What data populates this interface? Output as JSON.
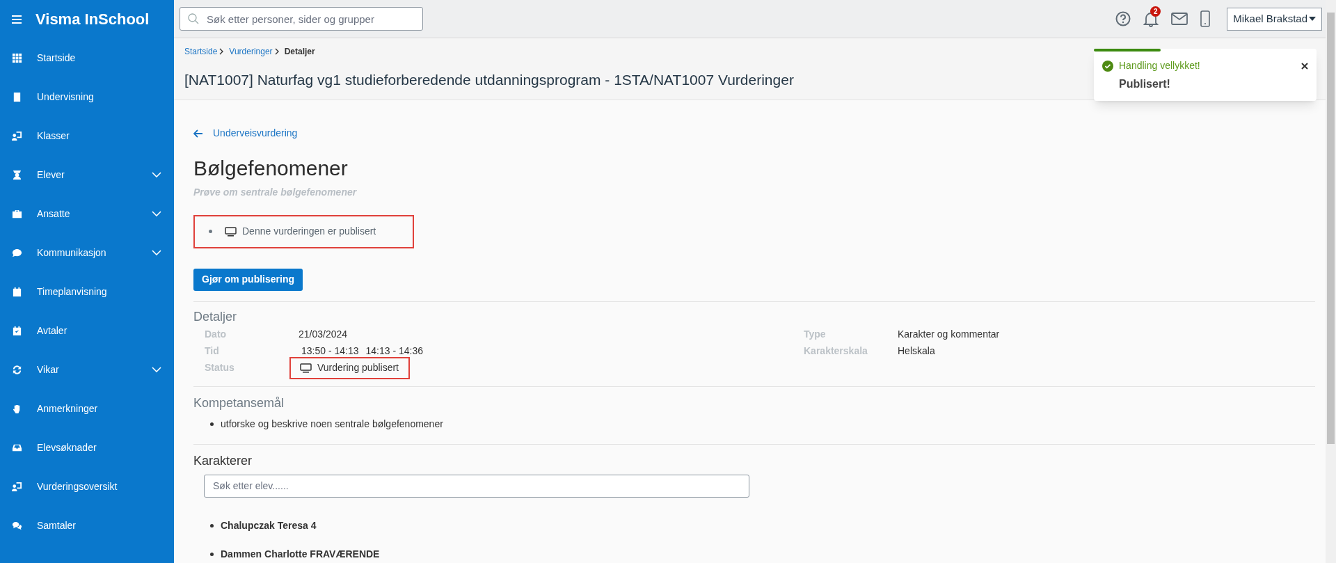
{
  "sidebar": {
    "title": "Visma InSchool",
    "items": [
      {
        "label": "Startside",
        "expandable": false
      },
      {
        "label": "Undervisning",
        "expandable": false
      },
      {
        "label": "Klasser",
        "expandable": false
      },
      {
        "label": "Elever",
        "expandable": true
      },
      {
        "label": "Ansatte",
        "expandable": true
      },
      {
        "label": "Kommunikasjon",
        "expandable": true
      },
      {
        "label": "Timeplanvisning",
        "expandable": false
      },
      {
        "label": "Avtaler",
        "expandable": false
      },
      {
        "label": "Vikar",
        "expandable": true
      },
      {
        "label": "Anmerkninger",
        "expandable": false
      },
      {
        "label": "Elevsøknader",
        "expandable": false
      },
      {
        "label": "Vurderingsoversikt",
        "expandable": false
      },
      {
        "label": "Samtaler",
        "expandable": false
      }
    ]
  },
  "topbar": {
    "search": {
      "placeholder": "Søk etter personer, sider og grupper"
    },
    "notification_count": "2",
    "user": "Mikael Brakstad"
  },
  "breadcrumb": [
    {
      "label": "Startside",
      "link": true
    },
    {
      "label": "Vurderinger",
      "link": true
    },
    {
      "label": "Detaljer",
      "link": false
    }
  ],
  "page_title": "[NAT1007] Naturfag vg1 studieforberedende utdanningsprogram - 1STA/NAT1007 Vurderinger",
  "toast": {
    "title": "Handling vellykket!",
    "message": "Publisert!",
    "level": 0.3
  },
  "back_link": "Underveisvurdering",
  "heading": "Bølgefenomener",
  "subtitle": "Prøve om sentrale bølgefenomener",
  "publish_notice": {
    "text": "Denne vurderingen er publisert",
    "highlighted": true
  },
  "publish_button": "Gjør om publisering",
  "details": {
    "title": "Detaljer",
    "left": [
      {
        "label": "Dato",
        "value": "21/03/2024",
        "kind": "text"
      },
      {
        "label": "Tid",
        "values": [
          "13:50 - 14:13",
          "14:13 - 14:36"
        ],
        "kind": "times"
      },
      {
        "label": "Status",
        "value": "Vurdering publisert",
        "kind": "status",
        "highlighted": true
      }
    ],
    "right": [
      {
        "label": "Type",
        "value": "Karakter og kommentar",
        "kind": "text"
      },
      {
        "label": "Karakterskala",
        "value": "Helskala",
        "kind": "text"
      }
    ]
  },
  "competence": {
    "title": "Kompetansemål",
    "items": [
      "utforske og beskrive noen sentrale bølgefenomener"
    ]
  },
  "grades": {
    "title": "Karakterer",
    "search": {
      "placeholder": "Søk etter elev......"
    },
    "students": [
      "Chalupczak Teresa 4",
      "Dammen Charlotte FRAVÆRENDE"
    ]
  }
}
